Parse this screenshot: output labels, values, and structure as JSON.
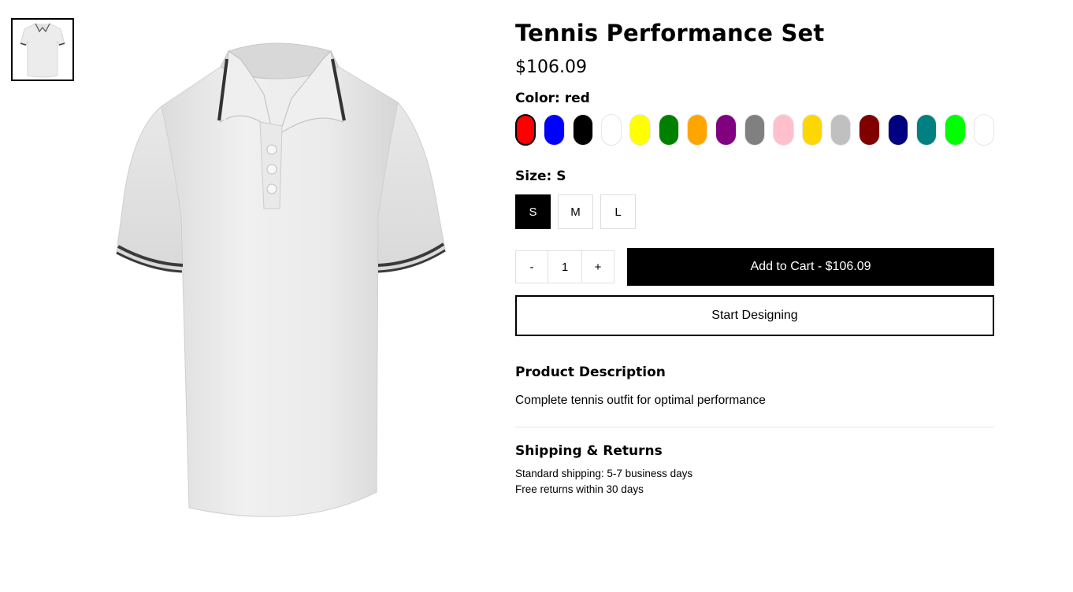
{
  "product": {
    "title": "Tennis Performance Set",
    "price": "$106.09",
    "image_alt": "white-polo-shirt"
  },
  "color": {
    "label": "Color:",
    "selected": "red",
    "swatches": [
      "#ff0000",
      "#0000ff",
      "#000000",
      "#ffffff",
      "#ffff00",
      "#008000",
      "#ffa500",
      "#800080",
      "#808080",
      "#ffc0cb",
      "#ffd700",
      "#c0c0c0",
      "#800000",
      "#000080",
      "#008080",
      "#00ff00",
      "#ffffff"
    ]
  },
  "size": {
    "label": "Size:",
    "selected": "S",
    "options": [
      "S",
      "M",
      "L"
    ]
  },
  "cart": {
    "decrement": "-",
    "quantity": "1",
    "increment": "+",
    "add_label": "Add to Cart - $106.09"
  },
  "design": {
    "label": "Start Designing"
  },
  "description": {
    "title": "Product Description",
    "text": "Complete tennis outfit for optimal performance"
  },
  "shipping": {
    "title": "Shipping & Returns",
    "line1": "Standard shipping: 5-7 business days",
    "line2": "Free returns within 30 days"
  }
}
